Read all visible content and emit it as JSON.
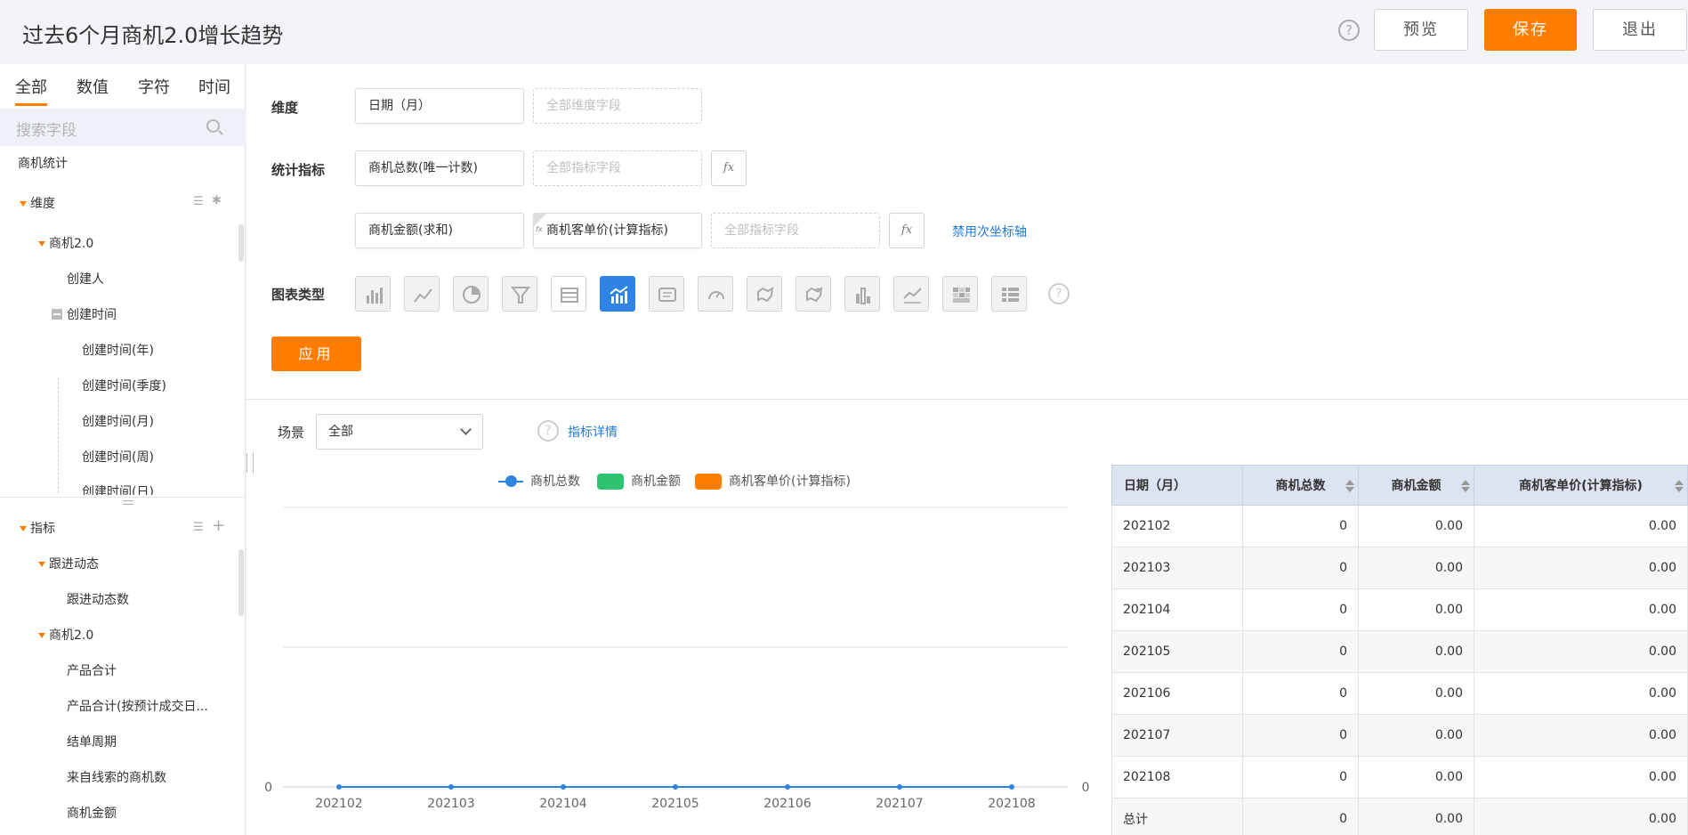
{
  "header": {
    "title": "过去6个月商机2.0增长趋势",
    "help_icon": "?",
    "preview_label": "预览",
    "save_label": "保存",
    "exit_label": "退出"
  },
  "sidebar": {
    "tabs": [
      "全部",
      "数值",
      "字符",
      "时间"
    ],
    "search_placeholder": "搜索字段",
    "source": "商机统计",
    "dimension_group": "维度",
    "dimension_sub": "商机2.0",
    "creator": "创建人",
    "create_time": "创建时间",
    "time_items": [
      "创建时间(年)",
      "创建时间(季度)",
      "创建时间(月)",
      "创建时间(周)",
      "创建时间(日)"
    ],
    "metric_group": "指标",
    "followup_group": "跟进动态",
    "followup_count": "跟进动态数",
    "metric_sub": "商机2.0",
    "metric_items": [
      "产品合计",
      "产品合计(按预计成交日...",
      "结单周期",
      "来自线索的商机数",
      "商机金额"
    ]
  },
  "config": {
    "dimension_label": "维度",
    "dimension_value": "日期（月）",
    "dimension_placeholder": "全部维度字段",
    "metric_label": "统计指标",
    "metric_1": "商机总数(唯一计数)",
    "metric_placeholder": "全部指标字段",
    "metric_2": "商机金额(求和)",
    "metric_3": "商机客单价(计算指标)",
    "fx_label": "fx",
    "fx_tag": "fx",
    "secondary_axis_link": "禁用次坐标轴",
    "chart_type_label": "图表类型",
    "chart_types": [
      "bar-chart-icon",
      "line-chart-icon",
      "pie-chart-icon",
      "funnel-chart-icon",
      "table-icon",
      "combo-chart-icon",
      "text-card-icon",
      "gauge-icon",
      "map-icon",
      "scatter-map-icon",
      "stacked-bar-icon",
      "area-chart-icon",
      "heatmap-icon",
      "pivot-table-icon"
    ],
    "selected_chart_type": "combo-chart-icon",
    "question_mark": "?",
    "apply_label": "应用"
  },
  "preview": {
    "scene_label": "场景",
    "scene_value": "全部",
    "metric_details_link": "指标详情",
    "question_mark": "?"
  },
  "chart_data": {
    "type": "line",
    "x": [
      "202102",
      "202103",
      "202104",
      "202105",
      "202106",
      "202107",
      "202108"
    ],
    "series": [
      {
        "name": "商机总数",
        "values": [
          0,
          0,
          0,
          0,
          0,
          0,
          0
        ],
        "color": "#2f84e3",
        "mark": "line"
      },
      {
        "name": "商机金额",
        "values": [
          0,
          0,
          0,
          0,
          0,
          0,
          0
        ],
        "color": "#2ec46f",
        "mark": "bar"
      },
      {
        "name": "商机客单价(计算指标)",
        "values": [
          0,
          0,
          0,
          0,
          0,
          0,
          0
        ],
        "color": "#ff7d00",
        "mark": "bar"
      }
    ],
    "y_left_label": "0",
    "y_right_label": "0",
    "legend": "top",
    "grid": true
  },
  "table": {
    "columns": [
      "日期（月）",
      "商机总数",
      "商机金额",
      "商机客单价(计算指标)"
    ],
    "rows": [
      [
        "202102",
        "0",
        "0.00",
        "0.00"
      ],
      [
        "202103",
        "0",
        "0.00",
        "0.00"
      ],
      [
        "202104",
        "0",
        "0.00",
        "0.00"
      ],
      [
        "202105",
        "0",
        "0.00",
        "0.00"
      ],
      [
        "202106",
        "0",
        "0.00",
        "0.00"
      ],
      [
        "202107",
        "0",
        "0.00",
        "0.00"
      ],
      [
        "202108",
        "0",
        "0.00",
        "0.00"
      ]
    ],
    "total": [
      "总计",
      "0",
      "0.00",
      "0.00"
    ]
  },
  "colors": {
    "accent": "#ff7d00",
    "selected": "#2f84e3",
    "link": "#1f7ad8"
  }
}
